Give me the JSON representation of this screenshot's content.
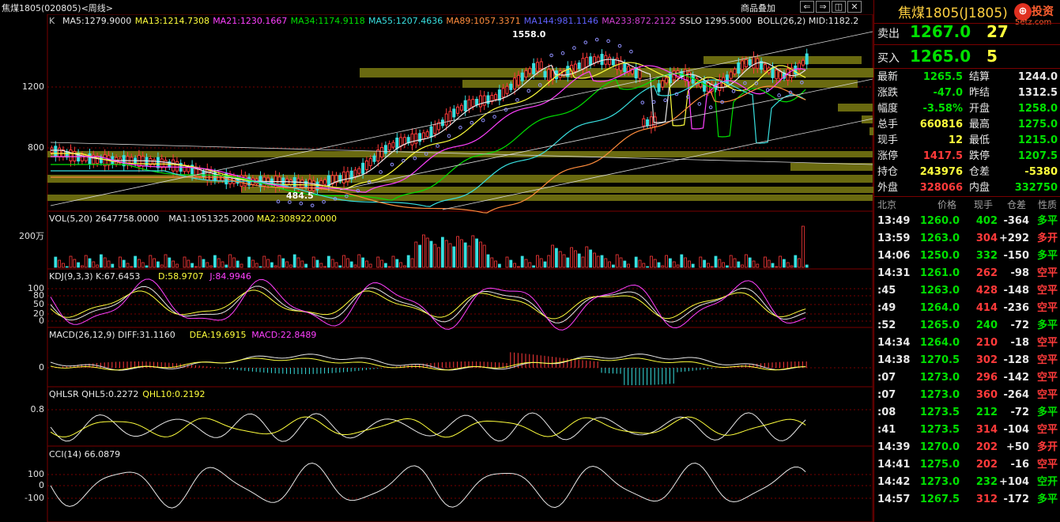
{
  "window": {
    "title": "焦煤1805(020805)<周线>",
    "overlay_button": "商品叠加",
    "nav_buttons": [
      "⇐",
      "⇒",
      "◫",
      "✕"
    ]
  },
  "watermark": {
    "text": "投资",
    "site": "5etz.com"
  },
  "main_chart": {
    "prefix": "K",
    "indicators": [
      {
        "label": "MA5:1279.9000",
        "color": "#e8e8e8"
      },
      {
        "label": "MA13:1214.7308",
        "color": "#ffff3c"
      },
      {
        "label": "MA21:1230.1667",
        "color": "#ff40ff"
      },
      {
        "label": "MA34:1174.9118",
        "color": "#00e000"
      },
      {
        "label": "MA55:1207.4636",
        "color": "#38e0e0"
      },
      {
        "label": "MA89:1057.3371",
        "color": "#ff8c3c"
      },
      {
        "label": "MA144:981.1146",
        "color": "#6060ff"
      },
      {
        "label": "MA233:872.2122",
        "color": "#d040d0"
      },
      {
        "label": "SSLO 1295.5000",
        "color": "#e8e8e8"
      },
      {
        "label": "BOLL(26,2) MID:1182.2",
        "color": "#e8e8e8"
      }
    ],
    "y_ticks": [
      "1200",
      "800"
    ],
    "annotations": {
      "high": "1558.0",
      "low": "484.5"
    }
  },
  "vol_panel": {
    "indicators": [
      {
        "label": "VOL(5,20) 2647758.0000",
        "color": "#e8e8e8"
      },
      {
        "label": "MA1:1051325.2000",
        "color": "#e8e8e8"
      },
      {
        "label": "MA2:308922.0000",
        "color": "#ffff3c"
      }
    ],
    "y_ticks": [
      "200万"
    ]
  },
  "kdj_panel": {
    "indicators": [
      {
        "label": "KDJ(9,3,3) K:67.6453",
        "color": "#e8e8e8"
      },
      {
        "label": "D:58.9707",
        "color": "#ffff3c"
      },
      {
        "label": "J:84.9946",
        "color": "#ff40ff"
      }
    ],
    "y_ticks": [
      "100",
      "80",
      "50",
      "20",
      "0"
    ]
  },
  "macd_panel": {
    "indicators": [
      {
        "label": "MACD(26,12,9) DIFF:31.1160",
        "color": "#e8e8e8"
      },
      {
        "label": "DEA:19.6915",
        "color": "#ffff3c"
      },
      {
        "label": "MACD:22.8489",
        "color": "#ff40ff"
      }
    ],
    "y_ticks": [
      "0"
    ]
  },
  "qhlsr_panel": {
    "indicators": [
      {
        "label": "QHLSR QHL5:0.2272",
        "color": "#e8e8e8"
      },
      {
        "label": "QHL10:0.2192",
        "color": "#ffff3c"
      }
    ],
    "y_ticks": [
      "0.8"
    ]
  },
  "cci_panel": {
    "indicators": [
      {
        "label": "CCI(14) 66.0879",
        "color": "#e8e8e8"
      }
    ],
    "y_ticks": [
      "100",
      "0",
      "-100"
    ]
  },
  "quote": {
    "name": "焦煤1805(J1805)",
    "sell": {
      "label": "卖出",
      "price": "1267.0",
      "qty": "27"
    },
    "buy": {
      "label": "买入",
      "price": "1265.0",
      "qty": "5"
    },
    "rows": [
      [
        {
          "t": "最新",
          "c": "wht"
        },
        {
          "t": "1265.5",
          "c": "grn"
        },
        {
          "t": "结算",
          "c": "wht"
        },
        {
          "t": "1244.0",
          "c": "wht"
        }
      ],
      [
        {
          "t": "涨跌",
          "c": "wht"
        },
        {
          "t": "-47.0",
          "c": "grn"
        },
        {
          "t": "昨结",
          "c": "wht"
        },
        {
          "t": "1312.5",
          "c": "wht"
        }
      ],
      [
        {
          "t": "幅度",
          "c": "wht"
        },
        {
          "t": "-3.58%",
          "c": "grn"
        },
        {
          "t": "开盘",
          "c": "wht"
        },
        {
          "t": "1258.0",
          "c": "grn"
        }
      ],
      [
        {
          "t": "总手",
          "c": "wht"
        },
        {
          "t": "660816",
          "c": "yel"
        },
        {
          "t": "最高",
          "c": "wht"
        },
        {
          "t": "1275.0",
          "c": "grn"
        }
      ],
      [
        {
          "t": "现手",
          "c": "wht"
        },
        {
          "t": "12",
          "c": "yel"
        },
        {
          "t": "最低",
          "c": "wht"
        },
        {
          "t": "1215.0",
          "c": "grn"
        }
      ],
      [
        {
          "t": "涨停",
          "c": "wht"
        },
        {
          "t": "1417.5",
          "c": "red"
        },
        {
          "t": "跌停",
          "c": "wht"
        },
        {
          "t": "1207.5",
          "c": "grn"
        }
      ],
      [
        {
          "t": "持仓",
          "c": "wht"
        },
        {
          "t": "243976",
          "c": "yel"
        },
        {
          "t": "仓差",
          "c": "wht"
        },
        {
          "t": "-5380",
          "c": "yel"
        }
      ],
      [
        {
          "t": "外盘",
          "c": "wht"
        },
        {
          "t": "328066",
          "c": "red"
        },
        {
          "t": "内盘",
          "c": "wht"
        },
        {
          "t": "332750",
          "c": "grn"
        }
      ]
    ],
    "tick_header": [
      "北京",
      "价格",
      "现手",
      "仓差",
      "性质"
    ],
    "ticks": [
      {
        "time": "13:49",
        "price": "1260.0",
        "vol": "402",
        "vc": "grn",
        "oi": "-364",
        "ty": "多平",
        "tc": "grn"
      },
      {
        "time": "13:59",
        "price": "1263.0",
        "vol": "304",
        "vc": "red",
        "oi": "+292",
        "ty": "多开",
        "tc": "red"
      },
      {
        "time": "14:06",
        "price": "1250.0",
        "vol": "332",
        "vc": "grn",
        "oi": "-150",
        "ty": "多平",
        "tc": "grn"
      },
      {
        "time": "14:31",
        "price": "1261.0",
        "vol": "262",
        "vc": "red",
        "oi": "-98",
        "ty": "空平",
        "tc": "red"
      },
      {
        "time": ":45",
        "price": "1263.0",
        "vol": "428",
        "vc": "red",
        "oi": "-148",
        "ty": "空平",
        "tc": "red"
      },
      {
        "time": ":49",
        "price": "1264.0",
        "vol": "414",
        "vc": "red",
        "oi": "-236",
        "ty": "空平",
        "tc": "red"
      },
      {
        "time": ":52",
        "price": "1265.0",
        "vol": "240",
        "vc": "grn",
        "oi": "-72",
        "ty": "多平",
        "tc": "grn"
      },
      {
        "time": "14:34",
        "price": "1264.0",
        "vol": "210",
        "vc": "red",
        "oi": "-18",
        "ty": "空平",
        "tc": "red"
      },
      {
        "time": "14:38",
        "price": "1270.5",
        "vol": "302",
        "vc": "red",
        "oi": "-128",
        "ty": "空平",
        "tc": "red"
      },
      {
        "time": ":07",
        "price": "1273.0",
        "vol": "296",
        "vc": "red",
        "oi": "-142",
        "ty": "空平",
        "tc": "red"
      },
      {
        "time": ":07",
        "price": "1273.0",
        "vol": "360",
        "vc": "red",
        "oi": "-264",
        "ty": "空平",
        "tc": "red"
      },
      {
        "time": ":08",
        "price": "1273.5",
        "vol": "212",
        "vc": "grn",
        "oi": "-72",
        "ty": "多平",
        "tc": "grn"
      },
      {
        "time": ":41",
        "price": "1273.5",
        "vol": "314",
        "vc": "red",
        "oi": "-104",
        "ty": "空平",
        "tc": "red"
      },
      {
        "time": "14:39",
        "price": "1270.0",
        "vol": "202",
        "vc": "red",
        "oi": "+50",
        "ty": "多开",
        "tc": "red"
      },
      {
        "time": "14:41",
        "price": "1275.0",
        "vol": "202",
        "vc": "red",
        "oi": "-16",
        "ty": "空平",
        "tc": "red"
      },
      {
        "time": "14:42",
        "price": "1273.0",
        "vol": "232",
        "vc": "grn",
        "oi": "+104",
        "ty": "空开",
        "tc": "grn"
      },
      {
        "time": "14:57",
        "price": "1267.5",
        "vol": "312",
        "vc": "red",
        "oi": "-172",
        "ty": "多平",
        "tc": "grn"
      }
    ]
  },
  "colors": {
    "up": "#ff3a3a",
    "down": "#38e0e0",
    "bg": "#000000",
    "grid": "#7a0000"
  }
}
